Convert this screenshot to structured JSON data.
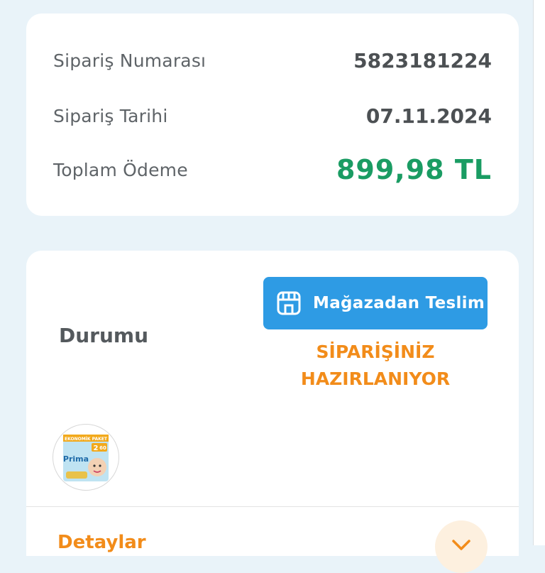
{
  "order_summary": {
    "order_number_label": "Sipariş Numarası",
    "order_number": "5823181224",
    "order_date_label": "Sipariş Tarihi",
    "order_date": "07.11.2024",
    "total_label": "Toplam Ödeme",
    "total": "899,98 TL"
  },
  "status": {
    "label": "Durumu",
    "pickup_badge": "Mağazadan Teslim",
    "status_text": "SİPARİŞİNİZ HAZIRLANIYOR",
    "product_thumb": {
      "brand": "Prima",
      "size": "2",
      "count": "60",
      "banner": "EKONOMİK PAKET"
    },
    "details_label": "Detaylar"
  },
  "colors": {
    "background": "#e9f3f9",
    "total_green": "#1a9c63",
    "badge_blue": "#2e9be4",
    "status_orange": "#f28c1a"
  },
  "icons": [
    "store-icon",
    "chevron-down-icon"
  ]
}
